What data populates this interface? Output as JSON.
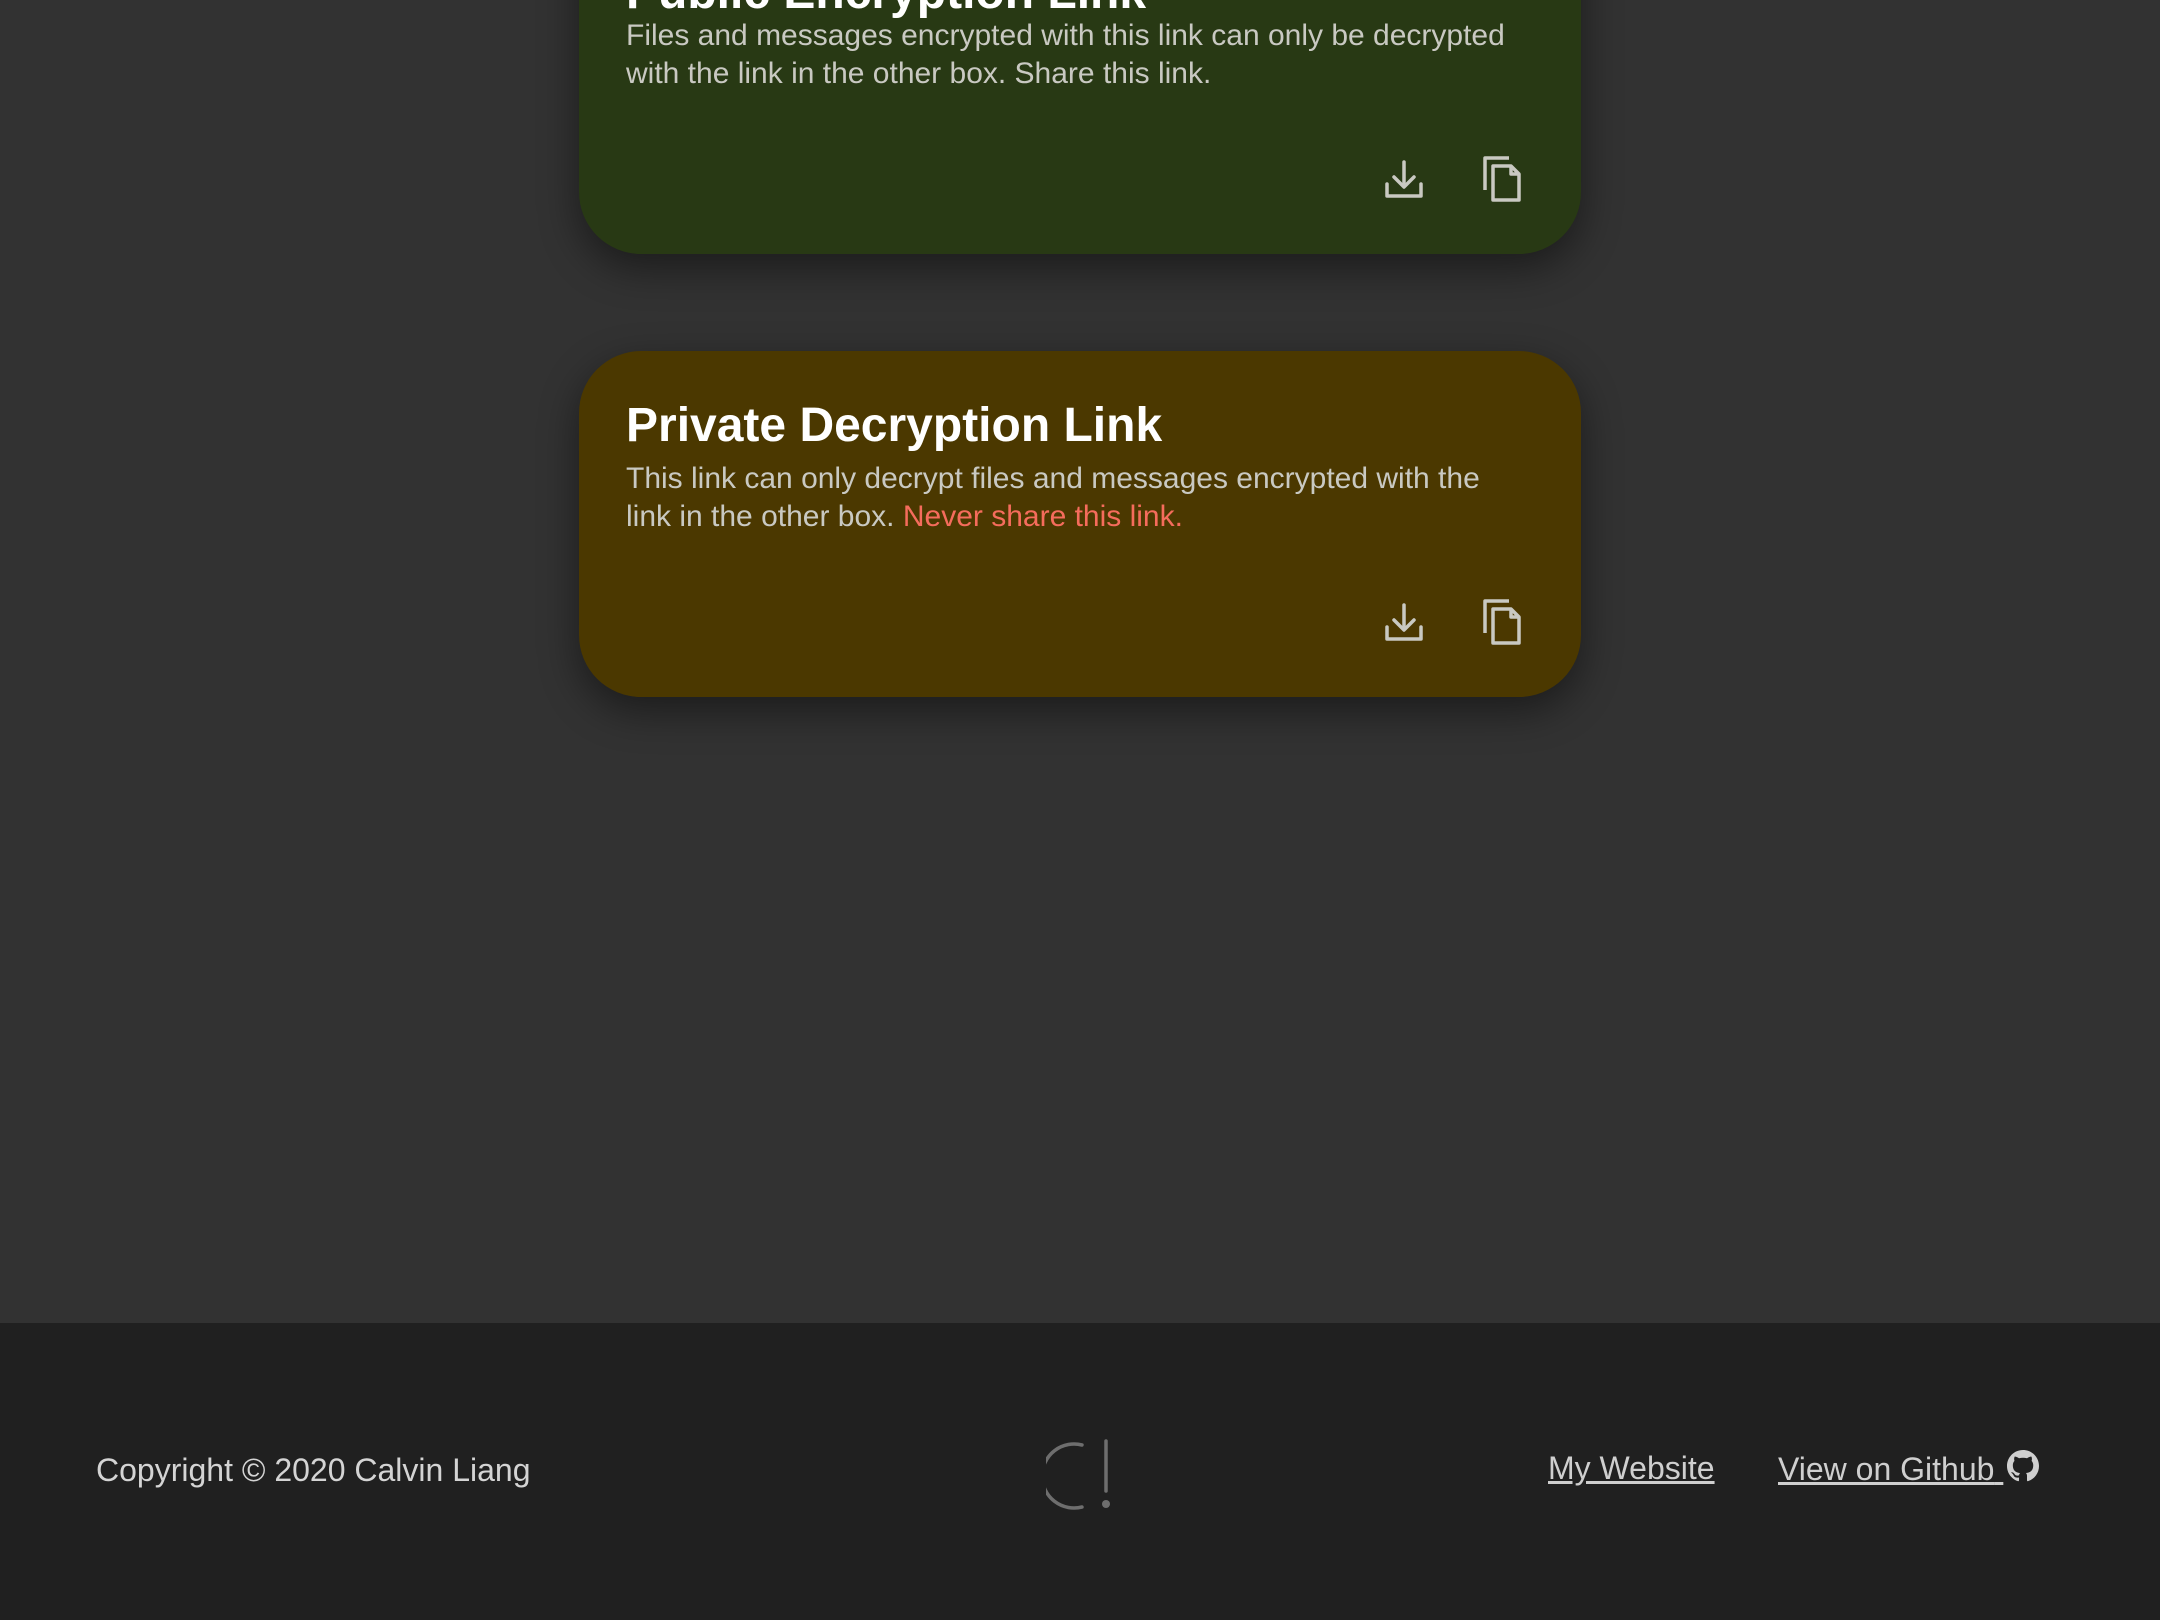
{
  "public_card": {
    "title": "Public Encryption Link",
    "description": "Files and messages encrypted with this link can only be decrypted with the link in the other box. Share this link.",
    "bg_color": "#283914"
  },
  "private_card": {
    "title": "Private Decryption Link",
    "description": "This link can only decrypt files and messages encrypted with the link in the other box.",
    "warning": "Never share this link.",
    "warning_color": "#f56c5c",
    "bg_color": "#4b3800"
  },
  "icons": {
    "download": "download-icon",
    "copy": "copy-icon",
    "github": "github-icon",
    "logo": "logo-icon"
  },
  "footer": {
    "copyright": "Copyright © 2020 Calvin Liang",
    "website_link": "My Website",
    "github_link": "View on Github"
  }
}
